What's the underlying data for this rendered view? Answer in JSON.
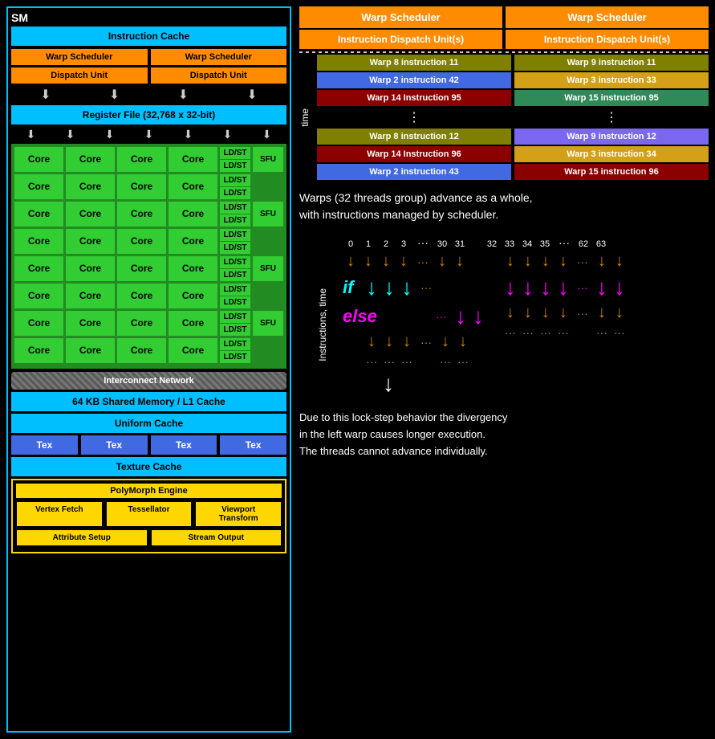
{
  "left": {
    "sm_label": "SM",
    "instruction_cache": "Instruction Cache",
    "warp_scheduler_1": "Warp Scheduler",
    "warp_scheduler_2": "Warp Scheduler",
    "dispatch_unit_1": "Dispatch Unit",
    "dispatch_unit_2": "Dispatch Unit",
    "register_file": "Register File (32,768 x 32-bit)",
    "cores": [
      [
        "Core",
        "Core",
        "Core",
        "Core"
      ],
      [
        "Core",
        "Core",
        "Core",
        "Core"
      ],
      [
        "Core",
        "Core",
        "Core",
        "Core"
      ],
      [
        "Core",
        "Core",
        "Core",
        "Core"
      ],
      [
        "Core",
        "Core",
        "Core",
        "Core"
      ],
      [
        "Core",
        "Core",
        "Core",
        "Core"
      ],
      [
        "Core",
        "Core",
        "Core",
        "Core"
      ],
      [
        "Core",
        "Core",
        "Core",
        "Core"
      ]
    ],
    "ldst_labels": [
      "LD/ST",
      "LD/ST",
      "LD/ST",
      "LD/ST"
    ],
    "sfu_label": "SFU",
    "interconnect": "Interconnect Network",
    "shared_memory": "64 KB Shared Memory / L1 Cache",
    "uniform_cache": "Uniform Cache",
    "tex_boxes": [
      "Tex",
      "Tex",
      "Tex",
      "Tex"
    ],
    "texture_cache": "Texture Cache",
    "polymorph_title": "PolyMorph Engine",
    "polymorph_row1": [
      "Vertex Fetch",
      "Tessellator",
      "Viewport\nTransform"
    ],
    "polymorph_row2": [
      "Attribute Setup",
      "Stream Output"
    ]
  },
  "right": {
    "warp_schedulers": [
      "Warp Scheduler",
      "Warp Scheduler"
    ],
    "dispatch_units": [
      "Instruction Dispatch Unit(s)",
      "Instruction Dispatch Unit(s)"
    ],
    "col1_instructions": [
      {
        "text": "Warp 8 instruction 11",
        "bg": "#808000"
      },
      {
        "text": "Warp 2 instruction 42",
        "bg": "#4169e1"
      },
      {
        "text": "Warp 14 Instruction 95",
        "bg": "#8b0000"
      },
      {
        "text": "⋮",
        "bg": "transparent"
      },
      {
        "text": "Warp 8 instruction 12",
        "bg": "#808000"
      },
      {
        "text": "Warp 14 Instruction 96",
        "bg": "#8b0000"
      },
      {
        "text": "Warp 2 instruction 43",
        "bg": "#4169e1"
      }
    ],
    "col2_instructions": [
      {
        "text": "Warp 9 instruction 11",
        "bg": "#808000"
      },
      {
        "text": "Warp 3 instruction 33",
        "bg": "#d4a017"
      },
      {
        "text": "Warp 15 instruction 95",
        "bg": "#2e8b57"
      },
      {
        "text": "⋮",
        "bg": "transparent"
      },
      {
        "text": "Warp 9 instruction 12",
        "bg": "#7b68ee"
      },
      {
        "text": "Warp 3 instruction 34",
        "bg": "#d4a017"
      },
      {
        "text": "Warp 15 instruction 96",
        "bg": "#8b0000"
      }
    ],
    "time_label": "time",
    "warps_description": "Warps (32 threads group) advance as a whole,\nwith instructions managed by scheduler.",
    "thread_numbers_left": [
      "0",
      "1",
      "2",
      "3",
      "...",
      "30",
      "31"
    ],
    "thread_numbers_right": [
      "32",
      "33",
      "34",
      "35",
      "...",
      "62",
      "63"
    ],
    "instructions_time_label": "Instructions, time",
    "if_label": "if",
    "else_label": "else",
    "bottom_description": "Due to this lock-step behavior the divergency\nin the left warp causes longer execution.\nThe threads cannot advance individually."
  }
}
